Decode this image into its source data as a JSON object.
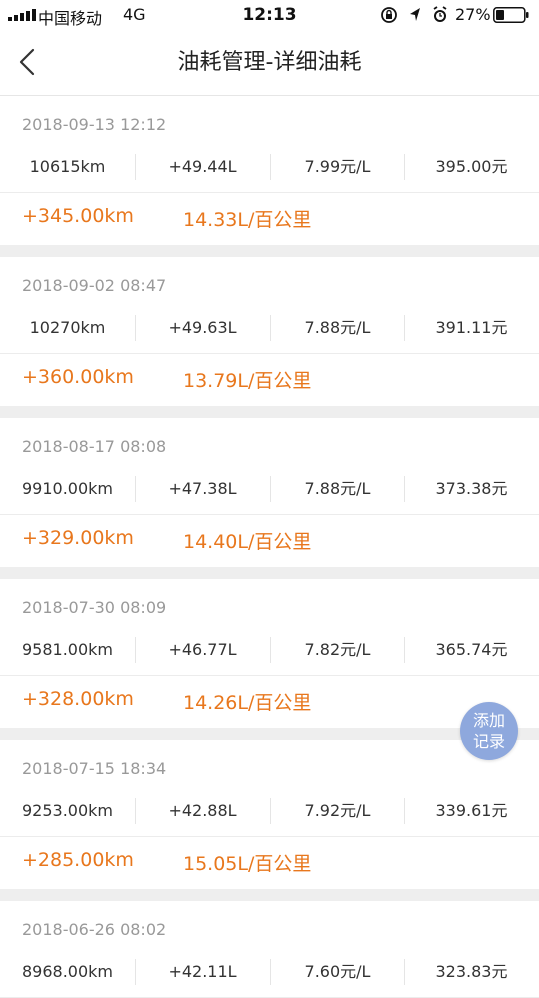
{
  "status_bar": {
    "carrier": "中国移动",
    "network": "4G",
    "time": "12:13",
    "battery": "27%"
  },
  "nav": {
    "title": "油耗管理-详细油耗"
  },
  "records": [
    {
      "date": "2018-09-13 12:12",
      "mileage": "10615km",
      "fuel": "+49.44L",
      "price": "7.99元/L",
      "cost": "395.00元",
      "distance": "+345.00km",
      "consumption": "14.33L/百公里"
    },
    {
      "date": "2018-09-02 08:47",
      "mileage": "10270km",
      "fuel": "+49.63L",
      "price": "7.88元/L",
      "cost": "391.11元",
      "distance": "+360.00km",
      "consumption": "13.79L/百公里"
    },
    {
      "date": "2018-08-17 08:08",
      "mileage": "9910.00km",
      "fuel": "+47.38L",
      "price": "7.88元/L",
      "cost": "373.38元",
      "distance": "+329.00km",
      "consumption": "14.40L/百公里"
    },
    {
      "date": "2018-07-30 08:09",
      "mileage": "9581.00km",
      "fuel": "+46.77L",
      "price": "7.82元/L",
      "cost": "365.74元",
      "distance": "+328.00km",
      "consumption": "14.26L/百公里"
    },
    {
      "date": "2018-07-15 18:34",
      "mileage": "9253.00km",
      "fuel": "+42.88L",
      "price": "7.92元/L",
      "cost": "339.61元",
      "distance": "+285.00km",
      "consumption": "15.05L/百公里"
    },
    {
      "date": "2018-06-26 08:02",
      "mileage": "8968.00km",
      "fuel": "+42.11L",
      "price": "7.60元/L",
      "cost": "323.83元",
      "distance": "",
      "consumption": ""
    }
  ],
  "fab": {
    "label": "添加记录"
  },
  "colors": {
    "accent_orange": "#e8771d",
    "fab_blue": "#8ea8dd",
    "section_gap": "#eeeeee"
  }
}
